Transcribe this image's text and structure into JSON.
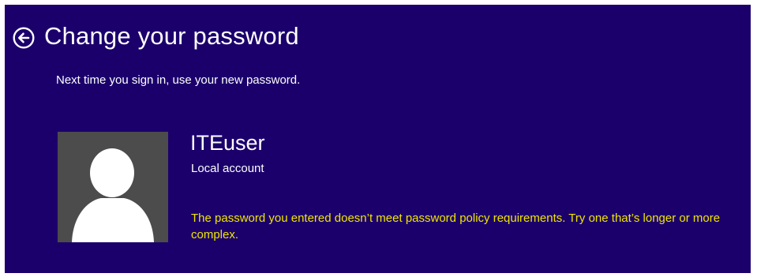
{
  "header": {
    "title": "Change your password",
    "back_icon": "back-arrow-circle-icon"
  },
  "subtitle": "Next time you sign in, use your new password.",
  "user": {
    "avatar_icon": "user-silhouette-icon",
    "name": "ITEuser",
    "account_type": "Local account"
  },
  "error_message": "The password you entered doesn’t meet password policy requirements. Try one that’s longer or more complex.",
  "colors": {
    "background": "#1b006c",
    "text": "#ffffff",
    "error": "#f0e500",
    "avatar_bg": "#4c4c4c"
  }
}
